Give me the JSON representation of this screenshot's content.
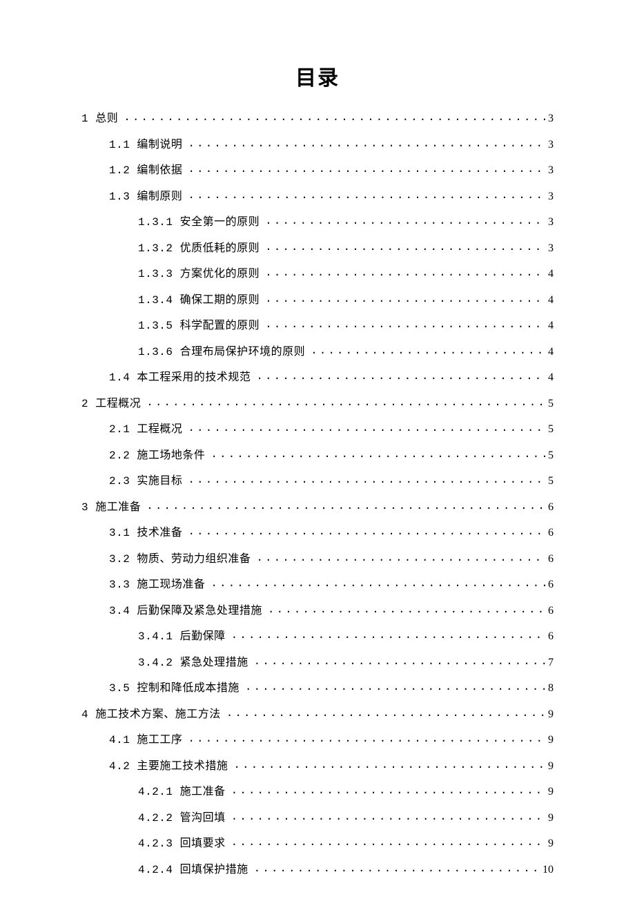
{
  "title": "目录",
  "entries": [
    {
      "indent": 0,
      "label": "1 总则",
      "page": "3"
    },
    {
      "indent": 1,
      "label": "1.1 编制说明",
      "page": "3"
    },
    {
      "indent": 1,
      "label": "1.2 编制依据",
      "page": "3"
    },
    {
      "indent": 1,
      "label": "1.3 编制原则",
      "page": "3"
    },
    {
      "indent": 2,
      "label": "1.3.1 安全第一的原则",
      "page": "3"
    },
    {
      "indent": 2,
      "label": "1.3.2 优质低耗的原则",
      "page": "3"
    },
    {
      "indent": 2,
      "label": "1.3.3 方案优化的原则",
      "page": "4"
    },
    {
      "indent": 2,
      "label": "1.3.4 确保工期的原则",
      "page": "4"
    },
    {
      "indent": 2,
      "label": "1.3.5 科学配置的原则",
      "page": "4"
    },
    {
      "indent": 2,
      "label": "1.3.6 合理布局保护环境的原则",
      "page": "4"
    },
    {
      "indent": 1,
      "label": "1.4 本工程采用的技术规范",
      "page": "4"
    },
    {
      "indent": 0,
      "label": "2 工程概况",
      "page": "5"
    },
    {
      "indent": 1,
      "label": "2.1 工程概况",
      "page": "5"
    },
    {
      "indent": 1,
      "label": "2.2 施工场地条件",
      "page": "5"
    },
    {
      "indent": 1,
      "label": "2.3 实施目标",
      "page": "5"
    },
    {
      "indent": 0,
      "label": "3 施工准备",
      "page": "6"
    },
    {
      "indent": 1,
      "label": "3.1 技术准备",
      "page": "6"
    },
    {
      "indent": 1,
      "label": "3.2 物质、劳动力组织准备",
      "page": "6"
    },
    {
      "indent": 1,
      "label": "3.3 施工现场准备",
      "page": "6"
    },
    {
      "indent": 1,
      "label": "3.4 后勤保障及紧急处理措施",
      "page": "6"
    },
    {
      "indent": 2,
      "label": "3.4.1 后勤保障",
      "page": "6"
    },
    {
      "indent": 2,
      "label": "3.4.2 紧急处理措施",
      "page": "7"
    },
    {
      "indent": 1,
      "label": "3.5 控制和降低成本措施",
      "page": "8"
    },
    {
      "indent": 0,
      "label": "4 施工技术方案、施工方法",
      "page": "9"
    },
    {
      "indent": 1,
      "label": "4.1 施工工序",
      "page": "9"
    },
    {
      "indent": 1,
      "label": "4.2 主要施工技术措施",
      "page": "9"
    },
    {
      "indent": 2,
      "label": "4.2.1 施工准备",
      "page": "9"
    },
    {
      "indent": 2,
      "label": "4.2.2 管沟回填",
      "page": "9"
    },
    {
      "indent": 2,
      "label": "4.2.3 回填要求",
      "page": "9"
    },
    {
      "indent": 2,
      "label": "4.2.4 回填保护措施",
      "page": "10"
    }
  ]
}
